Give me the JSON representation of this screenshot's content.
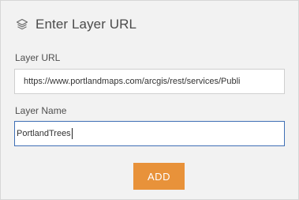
{
  "header": {
    "icon": "layers-icon",
    "title": "Enter Layer URL"
  },
  "form": {
    "url_label": "Layer URL",
    "url_value": "https://www.portlandmaps.com/arcgis/rest/services/Publi",
    "name_label": "Layer Name",
    "name_value": "PortlandTrees"
  },
  "actions": {
    "add_label": "ADD"
  },
  "colors": {
    "panel_bg": "#f2f2f2",
    "accent_orange": "#e8923a",
    "focus_border": "#3f6fb5"
  }
}
